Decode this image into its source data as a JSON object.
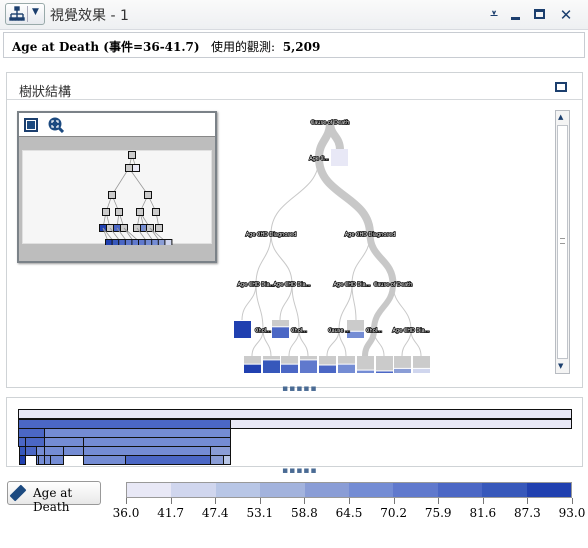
{
  "window": {
    "title": "視覺效果 - 1",
    "icons": [
      "tree-icon",
      "dropdown-arrow-icon",
      "menu-icon",
      "minimize-icon",
      "maximize-icon",
      "close-icon"
    ]
  },
  "info": {
    "target": "Age at Death (事件=36-41.7)",
    "obs_label": "使用的觀測:",
    "obs_value": "5,209"
  },
  "tree_panel": {
    "title": "樹狀結構",
    "nodes": {
      "root": "Cause of Death",
      "n1": "Age C...",
      "n2a": "Age CHD Diagnosed",
      "n2b": "Age CHD Diagnosed",
      "n3a": "Age CHD Dia...",
      "n3b": "Age CHD Dia...",
      "n3c": "Age CHD Dia...",
      "n3d": "Cause of Death",
      "n4a": "Chol...",
      "n4b": "Chol...",
      "n4c": "Cause ...",
      "n4d": "Chol...",
      "n4e": "Age CHD Dia..."
    }
  },
  "legend": {
    "variable": "Age at Death",
    "ticks": [
      "36.0",
      "41.7",
      "47.4",
      "53.1",
      "58.8",
      "64.5",
      "70.2",
      "75.9",
      "81.6",
      "87.3",
      "93.0"
    ],
    "colors": [
      "#e8e8f6",
      "#d0d6ee",
      "#b8c6e6",
      "#a3b3dd",
      "#8a9dd6",
      "#748cd4",
      "#6079cd",
      "#4b67c5",
      "#3758bb",
      "#2040b0"
    ]
  }
}
